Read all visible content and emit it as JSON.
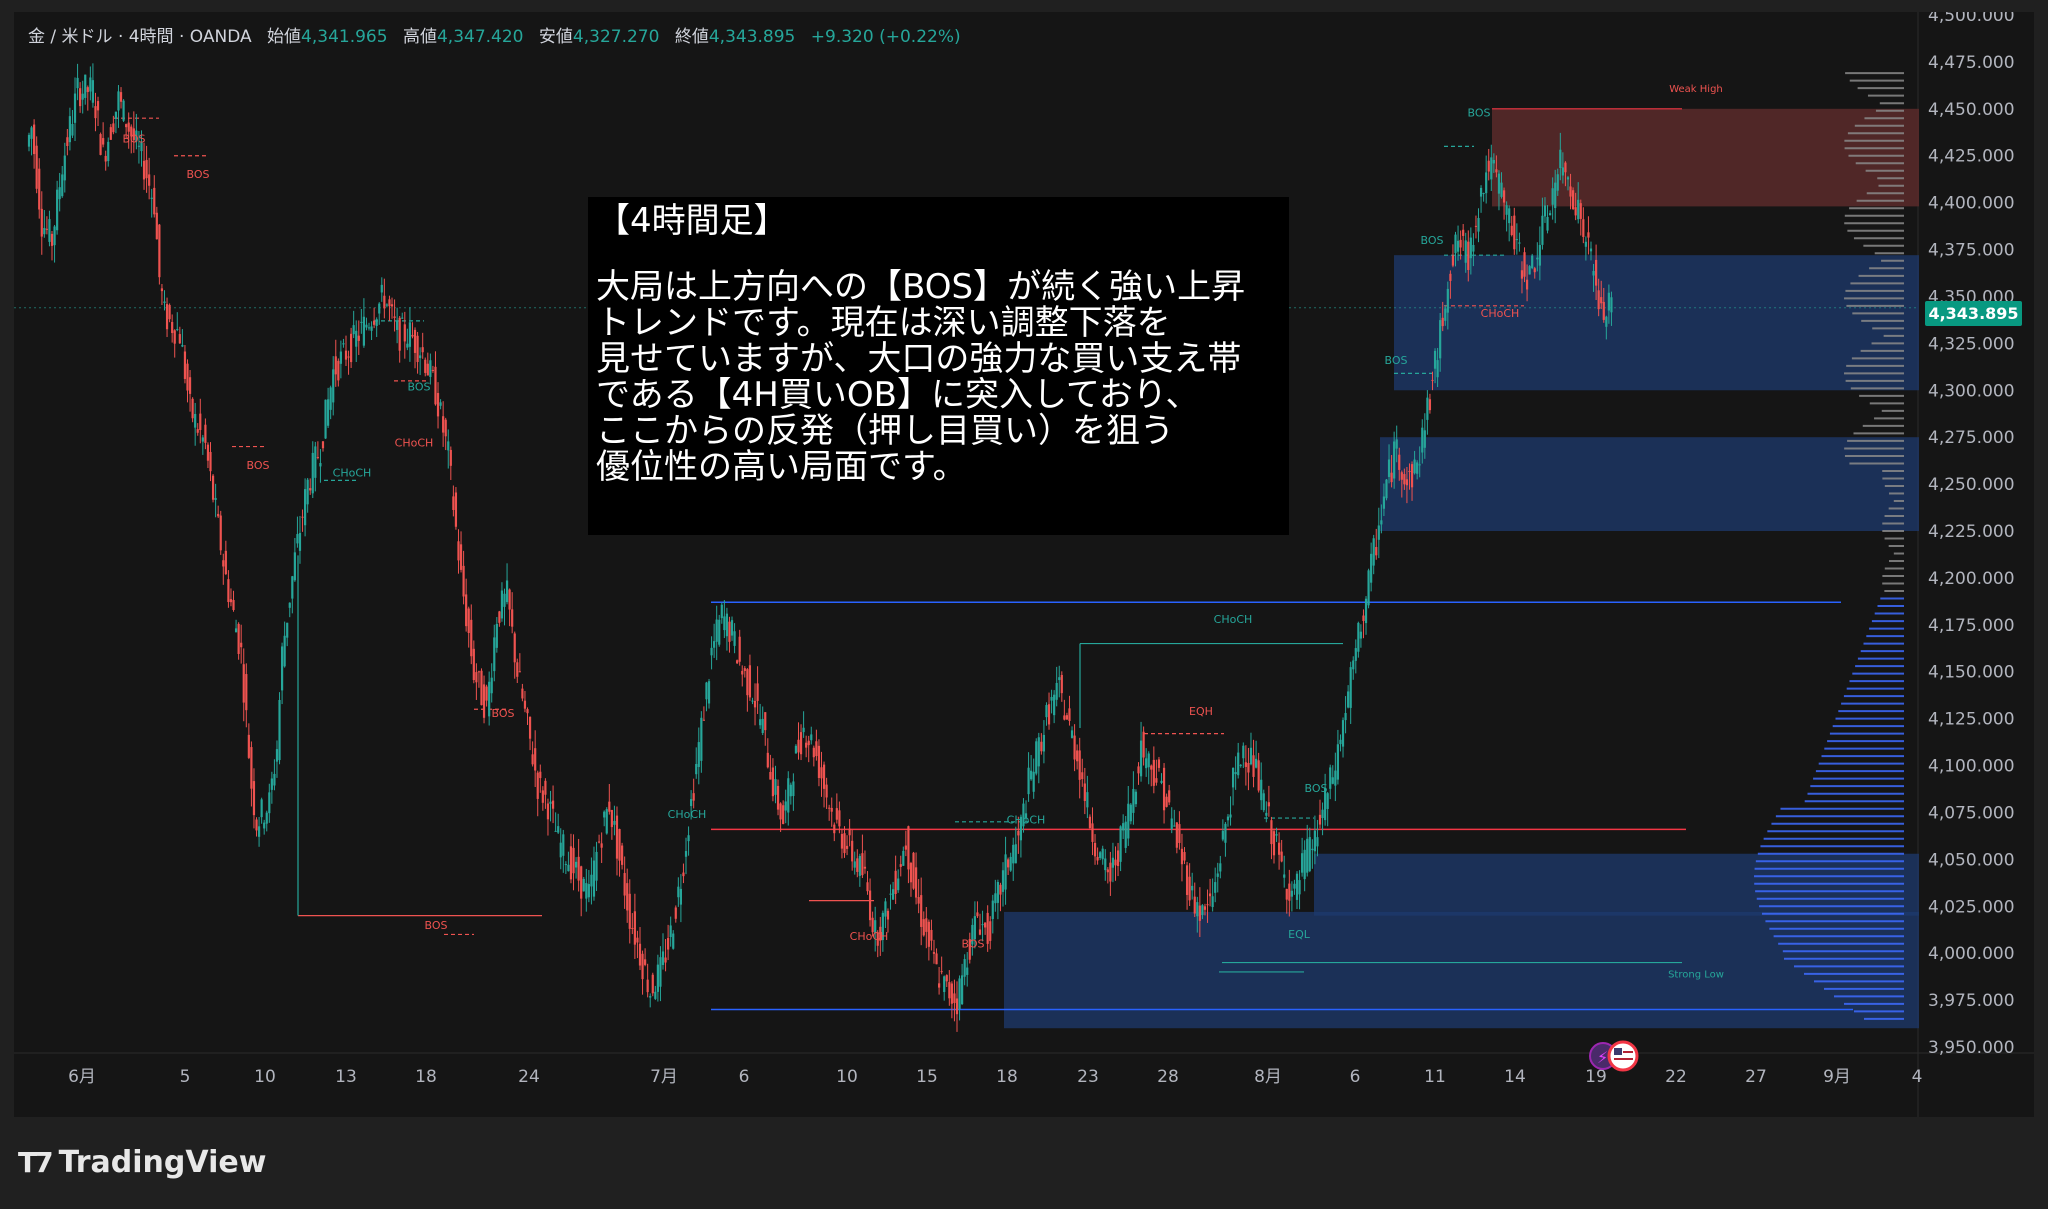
{
  "header": {
    "symbol": "金 / 米ドル · 4時間 · OANDA",
    "ohlc": [
      {
        "label": "始値",
        "value": "4,341.965"
      },
      {
        "label": "高値",
        "value": "4,347.420"
      },
      {
        "label": "安値",
        "value": "4,327.270"
      },
      {
        "label": "終値",
        "value": "4,343.895"
      }
    ],
    "change": "+9.320 (+0.22%)"
  },
  "annotation": {
    "heading": "【4時間足】",
    "body": "大局は上方向への【BOS】が続く強い上昇\nトレンドです。現在は深い調整下落を\n見せていますが、大口の強力な買い支え帯\nである【4H買いOB】に突入しており、\nここからの反発（押し目買い）を狙う\n優位性の高い局面です。"
  },
  "current_price": "4,343.895",
  "brand": {
    "name": "TradingView"
  },
  "colors": {
    "up": "#26a69a",
    "down": "#ef5350",
    "bg": "#151515",
    "ob_blue": "#1e3a6e",
    "ob_red": "#5a2a2a",
    "hline_blue": "#2962ff",
    "hline_red": "#f23645",
    "price_badge": "#089981"
  },
  "chart_data": {
    "type": "candlestick",
    "ylim": [
      3950,
      4500
    ],
    "y_ticks": [
      "4,500.000",
      "4,475.000",
      "4,450.000",
      "4,425.000",
      "4,400.000",
      "4,375.000",
      "4,350.000",
      "4,325.000",
      "4,300.000",
      "4,275.000",
      "4,250.000",
      "4,225.000",
      "4,200.000",
      "4,175.000",
      "4,150.000",
      "4,125.000",
      "4,100.000",
      "4,075.000",
      "4,050.000",
      "4,025.000",
      "4,000.000",
      "3,975.000",
      "3,950.000"
    ],
    "x_ticks": [
      "6月",
      "5",
      "10",
      "13",
      "18",
      "24",
      "7月",
      "6",
      "10",
      "15",
      "18",
      "23",
      "28",
      "8月",
      "6",
      "11",
      "14",
      "19",
      "22",
      "27",
      "9月",
      "4"
    ],
    "path_anchors": [
      [
        0,
        4430
      ],
      [
        2,
        4440
      ],
      [
        6,
        4390
      ],
      [
        10,
        4380
      ],
      [
        14,
        4420
      ],
      [
        20,
        4460
      ],
      [
        26,
        4460
      ],
      [
        30,
        4425
      ],
      [
        36,
        4455
      ],
      [
        40,
        4440
      ],
      [
        46,
        4420
      ],
      [
        50,
        4400
      ],
      [
        52,
        4360
      ],
      [
        54,
        4340
      ],
      [
        60,
        4330
      ],
      [
        64,
        4290
      ],
      [
        70,
        4270
      ],
      [
        78,
        4200
      ],
      [
        84,
        4160
      ],
      [
        88,
        4090
      ],
      [
        90,
        4070
      ],
      [
        95,
        4080
      ],
      [
        98,
        4110
      ],
      [
        100,
        4160
      ],
      [
        105,
        4210
      ],
      [
        110,
        4250
      ],
      [
        115,
        4270
      ],
      [
        120,
        4310
      ],
      [
        125,
        4320
      ],
      [
        130,
        4330
      ],
      [
        135,
        4340
      ],
      [
        140,
        4350
      ],
      [
        145,
        4330
      ],
      [
        150,
        4330
      ],
      [
        155,
        4320
      ],
      [
        160,
        4300
      ],
      [
        165,
        4265
      ],
      [
        170,
        4200
      ],
      [
        175,
        4150
      ],
      [
        180,
        4130
      ],
      [
        184,
        4180
      ],
      [
        188,
        4190
      ],
      [
        192,
        4150
      ],
      [
        196,
        4120
      ],
      [
        200,
        4090
      ],
      [
        204,
        4080
      ],
      [
        208,
        4060
      ],
      [
        212,
        4050
      ],
      [
        216,
        4040
      ],
      [
        220,
        4030
      ],
      [
        224,
        4060
      ],
      [
        228,
        4080
      ],
      [
        232,
        4050
      ],
      [
        236,
        4020
      ],
      [
        240,
        4000
      ],
      [
        244,
        3980
      ],
      [
        248,
        3990
      ],
      [
        252,
        4010
      ],
      [
        256,
        4040
      ],
      [
        260,
        4080
      ],
      [
        264,
        4120
      ],
      [
        268,
        4160
      ],
      [
        272,
        4180
      ],
      [
        276,
        4170
      ],
      [
        280,
        4150
      ],
      [
        284,
        4140
      ],
      [
        288,
        4120
      ],
      [
        292,
        4090
      ],
      [
        296,
        4070
      ],
      [
        300,
        4100
      ],
      [
        304,
        4120
      ],
      [
        308,
        4110
      ],
      [
        312,
        4090
      ],
      [
        316,
        4070
      ],
      [
        320,
        4060
      ],
      [
        324,
        4050
      ],
      [
        328,
        4040
      ],
      [
        332,
        4010
      ],
      [
        336,
        4020
      ],
      [
        340,
        4040
      ],
      [
        344,
        4060
      ],
      [
        348,
        4030
      ],
      [
        352,
        4010
      ],
      [
        356,
        3990
      ],
      [
        360,
        3980
      ],
      [
        364,
        3975
      ],
      [
        368,
        4000
      ],
      [
        372,
        4020
      ],
      [
        376,
        4010
      ],
      [
        380,
        4030
      ],
      [
        384,
        4050
      ],
      [
        388,
        4060
      ],
      [
        392,
        4090
      ],
      [
        396,
        4110
      ],
      [
        400,
        4130
      ],
      [
        404,
        4140
      ],
      [
        408,
        4120
      ],
      [
        412,
        4100
      ],
      [
        416,
        4070
      ],
      [
        420,
        4050
      ],
      [
        424,
        4040
      ],
      [
        428,
        4060
      ],
      [
        432,
        4080
      ],
      [
        436,
        4110
      ],
      [
        440,
        4100
      ],
      [
        444,
        4090
      ],
      [
        448,
        4070
      ],
      [
        452,
        4050
      ],
      [
        456,
        4030
      ],
      [
        460,
        4020
      ],
      [
        464,
        4030
      ],
      [
        468,
        4060
      ],
      [
        472,
        4090
      ],
      [
        476,
        4110
      ],
      [
        480,
        4100
      ],
      [
        484,
        4080
      ],
      [
        488,
        4060
      ],
      [
        492,
        4040
      ],
      [
        496,
        4030
      ],
      [
        500,
        4050
      ],
      [
        504,
        4060
      ],
      [
        508,
        4080
      ],
      [
        512,
        4100
      ],
      [
        516,
        4130
      ],
      [
        520,
        4160
      ],
      [
        524,
        4190
      ],
      [
        528,
        4220
      ],
      [
        532,
        4250
      ],
      [
        536,
        4270
      ],
      [
        540,
        4250
      ],
      [
        544,
        4260
      ],
      [
        548,
        4290
      ],
      [
        552,
        4320
      ],
      [
        556,
        4360
      ],
      [
        560,
        4380
      ],
      [
        564,
        4370
      ],
      [
        568,
        4400
      ],
      [
        572,
        4420
      ],
      [
        576,
        4410
      ],
      [
        580,
        4390
      ],
      [
        584,
        4370
      ],
      [
        588,
        4360
      ],
      [
        592,
        4380
      ],
      [
        596,
        4400
      ],
      [
        600,
        4420
      ],
      [
        604,
        4410
      ],
      [
        608,
        4390
      ],
      [
        612,
        4370
      ],
      [
        616,
        4340
      ],
      [
        620,
        4344
      ]
    ],
    "order_blocks": [
      {
        "side": "sell",
        "top": 4450,
        "bottom": 4398
      },
      {
        "side": "buy",
        "top": 4372,
        "bottom": 4300
      },
      {
        "side": "buy",
        "top": 4275,
        "bottom": 4225
      },
      {
        "side": "buy",
        "top": 4053,
        "bottom": 4020
      },
      {
        "side": "buy",
        "top": 4022,
        "bottom": 3960
      }
    ],
    "horizontal_lines": [
      {
        "y": 4187,
        "color": "blue"
      },
      {
        "y": 3970,
        "color": "blue"
      },
      {
        "y": 4066,
        "color": "red"
      }
    ],
    "structure_labels": [
      {
        "text": "BOS",
        "x": 120,
        "y": 4432,
        "color": "red"
      },
      {
        "text": "BOS",
        "x": 184,
        "y": 4413,
        "color": "red"
      },
      {
        "text": "BOS",
        "x": 405,
        "y": 4300,
        "color": "teal"
      },
      {
        "text": "CHoCH",
        "x": 400,
        "y": 4270,
        "color": "red"
      },
      {
        "text": "BOS",
        "x": 244,
        "y": 4258,
        "color": "red"
      },
      {
        "text": "CHoCH",
        "x": 338,
        "y": 4254,
        "color": "teal"
      },
      {
        "text": "BOS",
        "x": 489,
        "y": 4126,
        "color": "red"
      },
      {
        "text": "BOS",
        "x": 422,
        "y": 4013,
        "color": "red"
      },
      {
        "text": "CHoCH",
        "x": 1219,
        "y": 4176,
        "color": "teal"
      },
      {
        "text": "EQH",
        "x": 1187,
        "y": 4127,
        "color": "red"
      },
      {
        "text": "CHoCH",
        "x": 1012,
        "y": 4069,
        "color": "teal"
      },
      {
        "text": "CHoCH",
        "x": 673,
        "y": 4072,
        "color": "teal"
      },
      {
        "text": "CHoCH",
        "x": 855,
        "y": 4007,
        "color": "red"
      },
      {
        "text": "BOS",
        "x": 959,
        "y": 4003,
        "color": "red"
      },
      {
        "text": "BOS",
        "x": 1302,
        "y": 4086,
        "color": "teal"
      },
      {
        "text": "EQL",
        "x": 1285,
        "y": 4008,
        "color": "teal"
      },
      {
        "text": "Strong Low",
        "x": 1682,
        "y": 3987,
        "color": "teal"
      },
      {
        "text": "BOS",
        "x": 1382,
        "y": 4314,
        "color": "teal"
      },
      {
        "text": "BOS",
        "x": 1418,
        "y": 4378,
        "color": "teal"
      },
      {
        "text": "CHoCH",
        "x": 1486,
        "y": 4339,
        "color": "red"
      },
      {
        "text": "BOS",
        "x": 1465,
        "y": 4446,
        "color": "teal"
      },
      {
        "text": "Weak High",
        "x": 1682,
        "y": 4459,
        "color": "red"
      }
    ]
  }
}
